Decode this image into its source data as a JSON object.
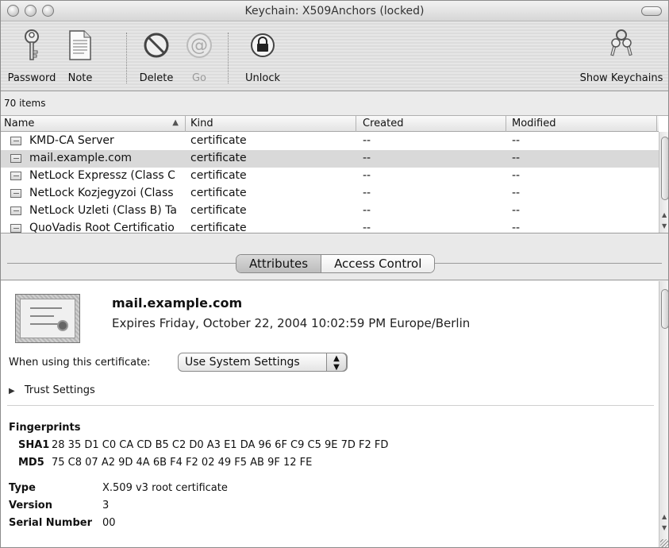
{
  "window": {
    "title": "Keychain: X509Anchors (locked)"
  },
  "toolbar": {
    "password": "Password",
    "note": "Note",
    "delete": "Delete",
    "go": "Go",
    "unlock": "Unlock",
    "show_keychains": "Show Keychains"
  },
  "list": {
    "count": "70 items",
    "columns": {
      "name": "Name",
      "kind": "Kind",
      "created": "Created",
      "modified": "Modified"
    },
    "rows": [
      {
        "name": "KMD-CA Server",
        "kind": "certificate",
        "created": "--",
        "modified": "--"
      },
      {
        "name": "mail.example.com",
        "kind": "certificate",
        "created": "--",
        "modified": "--",
        "selected": true
      },
      {
        "name": "NetLock Expressz (Class C",
        "kind": "certificate",
        "created": "--",
        "modified": "--"
      },
      {
        "name": "NetLock Kozjegyzoi (Class",
        "kind": "certificate",
        "created": "--",
        "modified": "--"
      },
      {
        "name": "NetLock Uzleti (Class B) Ta",
        "kind": "certificate",
        "created": "--",
        "modified": "--"
      },
      {
        "name": "QuoVadis Root Certificatio",
        "kind": "certificate",
        "created": "--",
        "modified": "--"
      }
    ]
  },
  "tabs": {
    "attributes": "Attributes",
    "access_control": "Access Control"
  },
  "detail": {
    "name": "mail.example.com",
    "expires": "Expires Friday, October 22, 2004 10:02:59 PM Europe/Berlin",
    "use_label": "When using this certificate:",
    "use_value": "Use System Settings",
    "trust_settings": "Trust Settings",
    "fingerprints_label": "Fingerprints",
    "sha1_label": "SHA1",
    "sha1_value": "28 35 D1 C0 CA CD B5 C2 D0 A3 E1 DA 96 6F C9 C5 9E 7D F2 FD",
    "md5_label": "MD5",
    "md5_value": "75 C8 07 A2 9D 4A 6B F4 F2 02 49 F5 AB 9F 12 FE",
    "type_label": "Type",
    "type_value": "X.509 v3 root certificate",
    "version_label": "Version",
    "version_value": "3",
    "serial_label": "Serial Number",
    "serial_value": "00"
  }
}
